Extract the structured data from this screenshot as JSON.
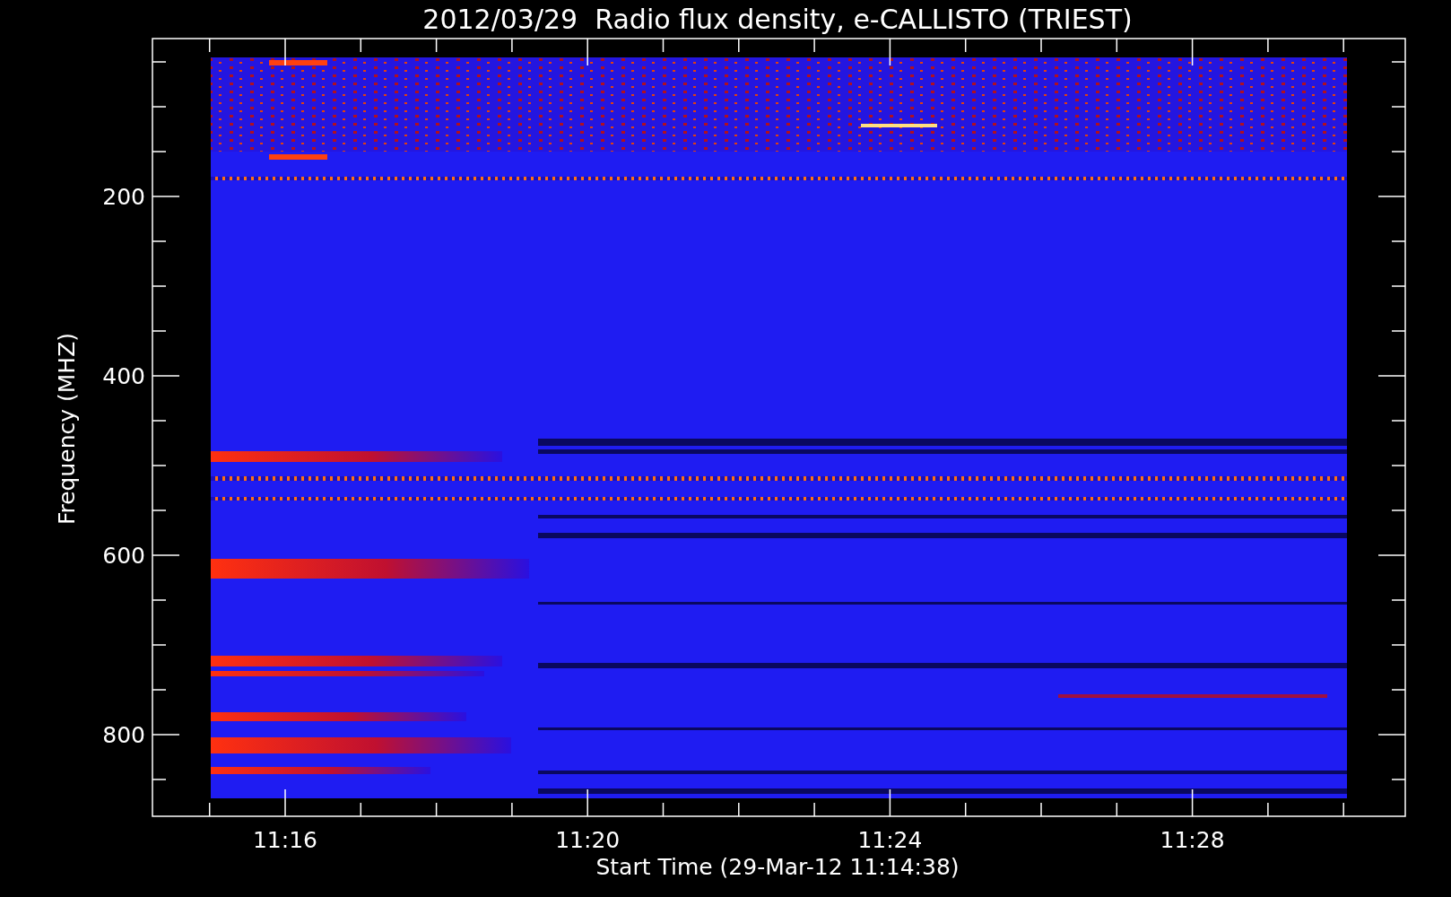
{
  "plot": {
    "title": "2012/03/29  Radio flux density, e-CALLISTO (TRIEST)",
    "ylabel": "Frequency (MHZ)",
    "xlabel": "Start Time (29-Mar-12 11:14:38)",
    "ytick_labels": [
      "200",
      "400",
      "600",
      "800"
    ],
    "xtick_labels": [
      "11:16",
      "11:20",
      "11:24",
      "11:28"
    ]
  }
}
